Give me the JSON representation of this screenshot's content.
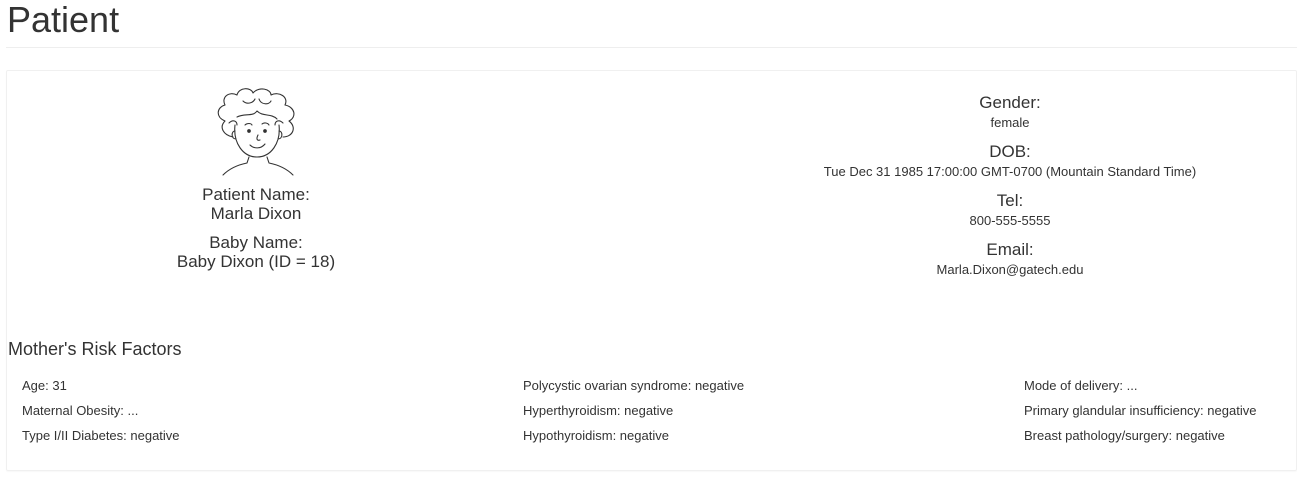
{
  "page": {
    "title": "Patient"
  },
  "patient": {
    "name_label": "Patient Name:",
    "name": "Marla Dixon",
    "baby_label": "Baby Name:",
    "baby_name": "Baby Dixon (ID = 18)",
    "avatar_icon": "patient-avatar-icon"
  },
  "details": {
    "gender_label": "Gender:",
    "gender": "female",
    "dob_label": "DOB:",
    "dob": "Tue Dec 31 1985 17:00:00 GMT-0700 (Mountain Standard Time)",
    "tel_label": "Tel:",
    "tel": "800-555-5555",
    "email_label": "Email:",
    "email": "Marla.Dixon@gatech.edu"
  },
  "risk_factors": {
    "title": "Mother's Risk Factors",
    "columns": [
      [
        "Age: 31",
        "Maternal Obesity: ...",
        "Type I/II Diabetes: negative"
      ],
      [
        "Polycystic ovarian syndrome: negative",
        "Hyperthyroidism: negative",
        "Hypothyroidism: negative"
      ],
      [
        "Mode of delivery: ...",
        "Primary glandular insufficiency: negative",
        "Breast pathology/surgery: negative"
      ]
    ]
  }
}
